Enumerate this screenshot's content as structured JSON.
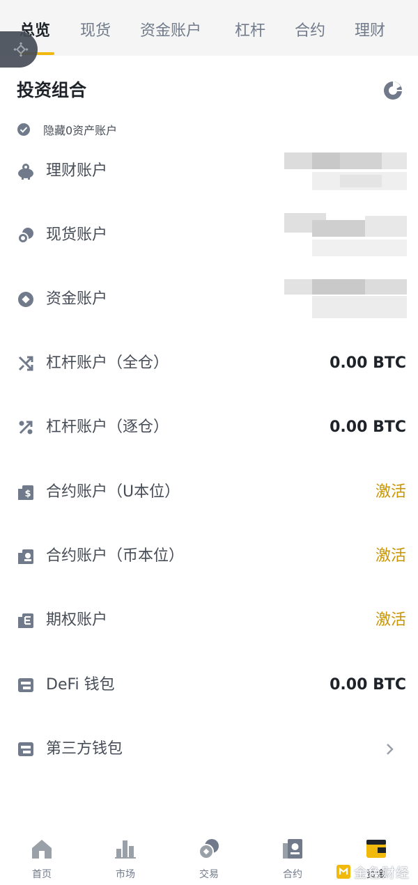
{
  "tabs": [
    {
      "label": "总览",
      "active": true
    },
    {
      "label": "现货"
    },
    {
      "label": "资金账户"
    },
    {
      "label": "杠杆"
    },
    {
      "label": "合约"
    },
    {
      "label": "理财"
    }
  ],
  "floating_button": {
    "icon": "binance-logo-icon"
  },
  "section": {
    "title": "投资组合",
    "pie_icon": "pie-chart-icon"
  },
  "hide_zero": {
    "label": "隐藏0资产账户",
    "checked": true
  },
  "accounts": [
    {
      "name": "理财账户",
      "icon": "piggy-bank-icon",
      "value": null,
      "blurred": true
    },
    {
      "name": "现货账户",
      "icon": "coins-icon",
      "value": null,
      "blurred": true
    },
    {
      "name": "资金账户",
      "icon": "diamond-coin-icon",
      "value": null,
      "blurred": true
    },
    {
      "name": "杠杆账户（全仓）",
      "icon": "cross-arrows-icon",
      "value": "0.00 BTC"
    },
    {
      "name": "杠杆账户（逐仓）",
      "icon": "percent-icon",
      "value": "0.00 BTC"
    },
    {
      "name": "合约账户（U本位）",
      "icon": "usd-futures-icon",
      "value": "激活",
      "action": true
    },
    {
      "name": "合约账户（币本位）",
      "icon": "coin-futures-icon",
      "value": "激活",
      "action": true
    },
    {
      "name": "期权账户",
      "icon": "options-icon",
      "value": "激活",
      "action": true
    },
    {
      "name": "DeFi 钱包",
      "icon": "wallet-icon",
      "value": "0.00 BTC"
    },
    {
      "name": "第三方钱包",
      "icon": "wallet-icon",
      "chevron": true
    }
  ],
  "bottom_nav": [
    {
      "label": "首页",
      "icon": "home-icon"
    },
    {
      "label": "市场",
      "icon": "market-bars-icon"
    },
    {
      "label": "交易",
      "icon": "trade-coins-icon"
    },
    {
      "label": "合约",
      "icon": "futures-icon"
    },
    {
      "label": "资金",
      "icon": "wallet-fund-icon",
      "active": true
    }
  ],
  "watermark": {
    "text": "金色财经"
  },
  "colors": {
    "accent": "#f0b90b",
    "activate": "#c99400",
    "text_primary": "#1e2329",
    "text_secondary": "#474d57",
    "icon_gray": "#707a8a"
  }
}
